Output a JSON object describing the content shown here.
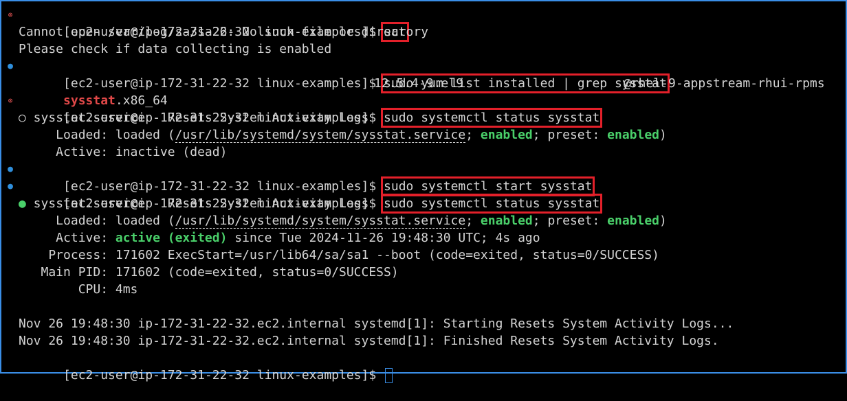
{
  "prompt": "[ec2-user@ip-172-31-22-32 linux-examples]$ ",
  "cmd1": "sar",
  "out1_line1": "Cannot open /var/log/sa/sa26: No such file or directory",
  "out1_line2": "Please check if data collecting is enabled",
  "cmd2": "sudo yum list installed | grep sysstat",
  "pkg_name": "sysstat",
  "pkg_arch": ".x86_64",
  "pkg_version": "12.5.4-9.el9",
  "pkg_repo": "@rhel-9-appstream-rhui-rpms",
  "cmd3": "sudo systemctl status sysstat",
  "status1": {
    "bullet": "○",
    "title": " sysstat.service - Resets System Activity Logs",
    "loaded_label": "     Loaded: loaded (",
    "unit_path": "/usr/lib/systemd/system/sysstat.service",
    "sep1": "; ",
    "enabled": "enabled",
    "sep2": "; preset: ",
    "preset": "enabled",
    "close": ")",
    "active": "     Active: inactive (dead)"
  },
  "cmd4": "sudo systemctl start sysstat",
  "cmd5": "sudo systemctl status sysstat",
  "status2": {
    "bullet": "●",
    "title": " sysstat.service - Resets System Activity Logs",
    "loaded_label": "     Loaded: loaded (",
    "unit_path": "/usr/lib/systemd/system/sysstat.service",
    "sep1": "; ",
    "enabled": "enabled",
    "sep2": "; preset: ",
    "preset": "enabled",
    "close": ")",
    "active_label": "     Active: ",
    "active_state": "active (exited)",
    "active_rest": " since Tue 2024-11-26 19:48:30 UTC; 4s ago",
    "process": "    Process: 171602 ExecStart=/usr/lib64/sa/sa1 --boot (code=exited, status=0/SUCCESS)",
    "main_pid": "   Main PID: 171602 (code=exited, status=0/SUCCESS)",
    "cpu": "        CPU: 4ms"
  },
  "log1": "Nov 26 19:48:30 ip-172-31-22-32.ec2.internal systemd[1]: Starting Resets System Activity Logs...",
  "log2": "Nov 26 19:48:30 ip-172-31-22-32.ec2.internal systemd[1]: Finished Resets System Activity Logs.",
  "marks": {
    "error": "⊗",
    "success": "●"
  },
  "colors": {
    "highlight": "#e3202a",
    "enabled_green": "#4ad06a",
    "pkg_red": "#e04848",
    "border_blue": "#3a8ee6"
  }
}
